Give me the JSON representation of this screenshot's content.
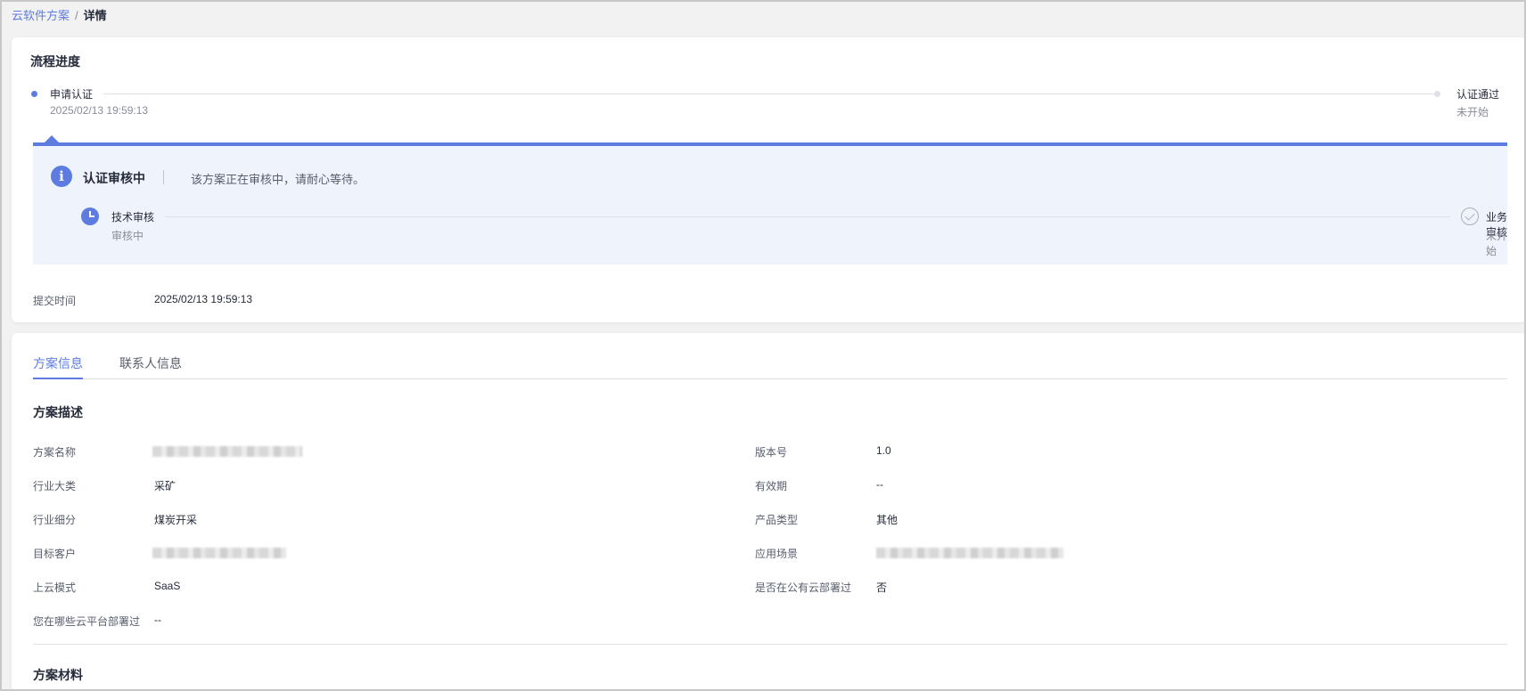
{
  "breadcrumb": {
    "parent": "云软件方案",
    "separator": "/",
    "current": "详情"
  },
  "process": {
    "title": "流程进度",
    "steps": [
      {
        "label": "申请认证",
        "sub": "2025/02/13 19:59:13",
        "status": "active"
      },
      {
        "label": "认证通过",
        "sub": "未开始",
        "status": "pending"
      }
    ],
    "status_panel": {
      "title": "认证审核中",
      "message": "该方案正在审核中，请耐心等待。",
      "substeps": [
        {
          "label": "技术审核",
          "sub": "审核中",
          "icon": "clock-icon"
        },
        {
          "label": "业务审核",
          "sub": "未开始",
          "icon": "check-circle-icon"
        }
      ]
    },
    "submit_time_label": "提交时间",
    "submit_time_value": "2025/02/13 19:59:13"
  },
  "tabs": [
    {
      "label": "方案信息",
      "active": true
    },
    {
      "label": "联系人信息",
      "active": false
    }
  ],
  "description": {
    "title": "方案描述",
    "left_fields": [
      {
        "label": "方案名称",
        "value": "",
        "blurred": true
      },
      {
        "label": "行业大类",
        "value": "采矿"
      },
      {
        "label": "行业细分",
        "value": "煤炭开采"
      },
      {
        "label": "目标客户",
        "value": "",
        "blurred": true
      },
      {
        "label": "上云模式",
        "value": "SaaS"
      },
      {
        "label": "您在哪些云平台部署过",
        "value": "--"
      }
    ],
    "right_fields": [
      {
        "label": "版本号",
        "value": "1.0"
      },
      {
        "label": "有效期",
        "value": "--"
      },
      {
        "label": "产品类型",
        "value": "其他"
      },
      {
        "label": "应用场景",
        "value": "",
        "blurred": true
      },
      {
        "label": "是否在公有云部署过",
        "value": "否"
      }
    ]
  },
  "materials": {
    "title": "方案材料"
  },
  "colors": {
    "accent": "#5e7ce0",
    "panel_bg": "#eff3fb",
    "page_bg": "#f2f2f2"
  }
}
